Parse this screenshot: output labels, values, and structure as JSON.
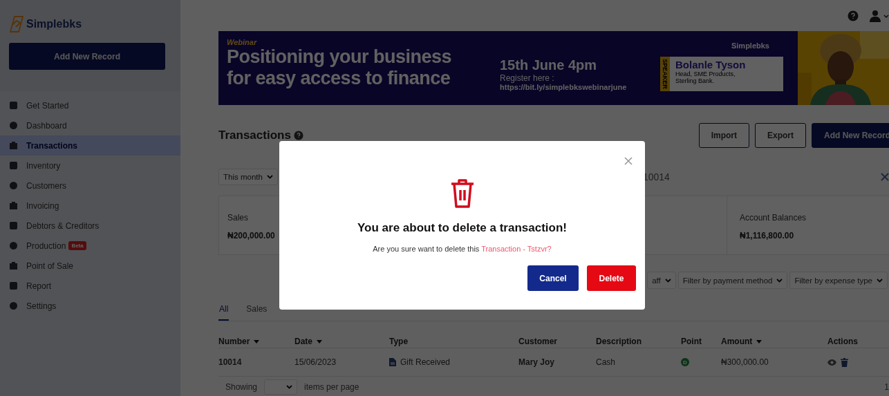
{
  "sidebar": {
    "logo": "Simplebks",
    "add_button": "Add New Record",
    "items": [
      {
        "label": "Get Started",
        "selected": false
      },
      {
        "label": "Dashboard",
        "selected": false
      },
      {
        "label": "Transactions",
        "selected": true
      },
      {
        "label": "Inventory",
        "selected": false
      },
      {
        "label": "Customers",
        "selected": false
      },
      {
        "label": "Invoicing",
        "selected": false
      },
      {
        "label": "Debtors & Creditors",
        "selected": false
      },
      {
        "label": "Production",
        "selected": false,
        "badge": "Beta"
      },
      {
        "label": "Point of Sale",
        "selected": false
      },
      {
        "label": "Report",
        "selected": false
      },
      {
        "label": "Settings",
        "selected": false
      }
    ]
  },
  "banner": {
    "tag": "Webinar",
    "headline": [
      "Positioning your business",
      "for easy access to finance"
    ],
    "date": "15th June 4pm",
    "register": "Register here :",
    "link": "https://bit.ly/simplebkswebinarjune",
    "brand": "Simplebks",
    "speaker_label": "SPEAKER",
    "speaker_name": "Bolanle Tyson",
    "speaker_role": [
      "Head, SME Products,",
      "Sterling Bank."
    ]
  },
  "page": {
    "title": "Transactions",
    "buttons": [
      "Import",
      "Export",
      "Add New Record"
    ],
    "period": "This month",
    "search_value": "10014",
    "cards": [
      {
        "label": "Sales",
        "value": "₦200,000.00"
      },
      {
        "label": "Account Balances",
        "value": "₦1,116,800.00"
      }
    ],
    "filters": [
      "aff",
      "Filter by payment method",
      "Filter by expense type"
    ],
    "tabs": [
      {
        "label": "All",
        "selected": true
      },
      {
        "label": "Sales",
        "selected": false
      }
    ]
  },
  "table": {
    "columns": [
      {
        "label": "Number",
        "sortable": true
      },
      {
        "label": "Date",
        "sortable": true
      },
      {
        "label": "Type",
        "sortable": false
      },
      {
        "label": "Customer",
        "sortable": false
      },
      {
        "label": "Description",
        "sortable": false
      },
      {
        "label": "Point",
        "sortable": false
      },
      {
        "label": "Amount",
        "sortable": true
      },
      {
        "label": "Actions",
        "sortable": false
      }
    ],
    "rows": [
      {
        "number": "10014",
        "date": "15/06/2023",
        "type": "Gift Received",
        "customer": "Mary Joy",
        "description": "Cash",
        "point": "D",
        "amount": "₦300,000.00"
      }
    ]
  },
  "pagination": {
    "label": "Showing",
    "suffix": "items per page",
    "page": "1"
  },
  "modal": {
    "title": "You are about to delete a transaction!",
    "message": "Are you sure want to delete this ",
    "highlight": "Transaction - Tstzvr?",
    "buttons": [
      "Cancel",
      "Delete"
    ]
  }
}
